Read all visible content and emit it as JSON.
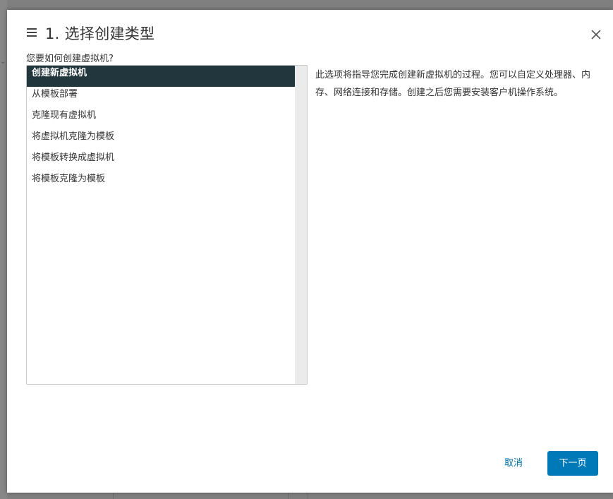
{
  "dialog": {
    "title": "1. 选择创建类型",
    "prompt": "您要如何创建虚拟机?",
    "options": [
      {
        "label": "创建新虚拟机",
        "selected": true
      },
      {
        "label": "从模板部署",
        "selected": false
      },
      {
        "label": "克隆现有虚拟机",
        "selected": false
      },
      {
        "label": "将虚拟机克隆为模板",
        "selected": false
      },
      {
        "label": "将模板转换成虚拟机",
        "selected": false
      },
      {
        "label": "将模板克隆为模板",
        "selected": false
      }
    ],
    "description": "此选项将指导您完成创建新虚拟机的过程。您可以自定义处理器、内存、网络连接和存储。创建之后您需要安装客户机操作系统。",
    "cancel_label": "取消",
    "next_label": "下一页"
  },
  "colors": {
    "selected_bg": "#22363d",
    "primary_button": "#0079b8",
    "link": "#0072a3"
  }
}
